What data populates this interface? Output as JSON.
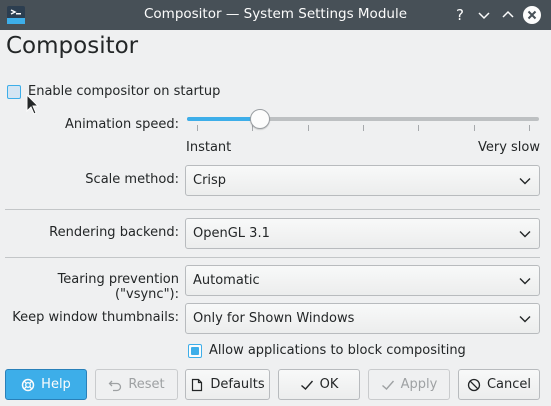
{
  "window": {
    "title": "Compositor — System Settings Module",
    "icon": "settings-app-icon",
    "controls": [
      "help-icon",
      "minimize-icon",
      "maximize-icon",
      "close-icon"
    ]
  },
  "page": {
    "title": "Compositor"
  },
  "enable_on_startup": {
    "label": "Enable compositor on startup",
    "checked": false
  },
  "animation_speed": {
    "label": "Animation speed:",
    "min_label": "Instant",
    "max_label": "Very slow",
    "value_fraction": 0.19,
    "tick_count": 7
  },
  "scale_method": {
    "label": "Scale method:",
    "value": "Crisp"
  },
  "rendering_backend": {
    "label": "Rendering backend:",
    "value": "OpenGL 3.1"
  },
  "tearing_prevention": {
    "label": "Tearing prevention (\"vsync\"):",
    "value": "Automatic"
  },
  "keep_thumbnails": {
    "label": "Keep window thumbnails:",
    "value": "Only for Shown Windows"
  },
  "allow_block": {
    "label": "Allow applications to block compositing",
    "checked": true
  },
  "buttons": {
    "help": "Help",
    "reset": "Reset",
    "defaults": "Defaults",
    "ok": "OK",
    "apply": "Apply",
    "cancel": "Cancel"
  },
  "colors": {
    "accent": "#3daee9",
    "titlebar": "#475057",
    "background": "#eff0f1"
  }
}
